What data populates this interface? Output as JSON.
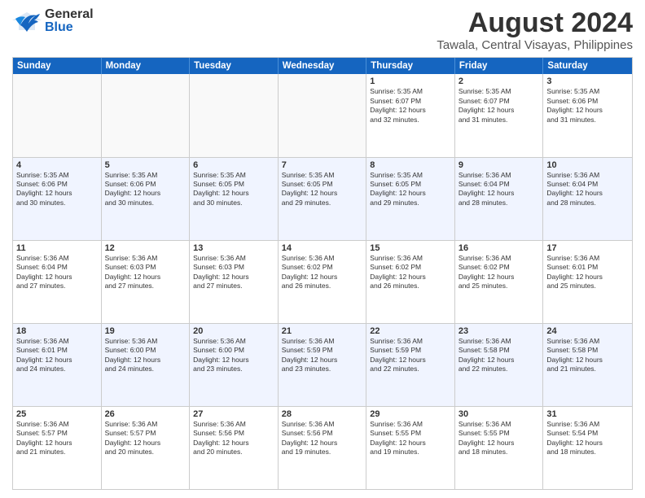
{
  "header": {
    "logo_general": "General",
    "logo_blue": "Blue",
    "title": "August 2024",
    "subtitle": "Tawala, Central Visayas, Philippines"
  },
  "days_of_week": [
    "Sunday",
    "Monday",
    "Tuesday",
    "Wednesday",
    "Thursday",
    "Friday",
    "Saturday"
  ],
  "weeks": [
    [
      {
        "day": "",
        "text": ""
      },
      {
        "day": "",
        "text": ""
      },
      {
        "day": "",
        "text": ""
      },
      {
        "day": "",
        "text": ""
      },
      {
        "day": "1",
        "text": "Sunrise: 5:35 AM\nSunset: 6:07 PM\nDaylight: 12 hours\nand 32 minutes."
      },
      {
        "day": "2",
        "text": "Sunrise: 5:35 AM\nSunset: 6:07 PM\nDaylight: 12 hours\nand 31 minutes."
      },
      {
        "day": "3",
        "text": "Sunrise: 5:35 AM\nSunset: 6:06 PM\nDaylight: 12 hours\nand 31 minutes."
      }
    ],
    [
      {
        "day": "4",
        "text": "Sunrise: 5:35 AM\nSunset: 6:06 PM\nDaylight: 12 hours\nand 30 minutes."
      },
      {
        "day": "5",
        "text": "Sunrise: 5:35 AM\nSunset: 6:06 PM\nDaylight: 12 hours\nand 30 minutes."
      },
      {
        "day": "6",
        "text": "Sunrise: 5:35 AM\nSunset: 6:05 PM\nDaylight: 12 hours\nand 30 minutes."
      },
      {
        "day": "7",
        "text": "Sunrise: 5:35 AM\nSunset: 6:05 PM\nDaylight: 12 hours\nand 29 minutes."
      },
      {
        "day": "8",
        "text": "Sunrise: 5:35 AM\nSunset: 6:05 PM\nDaylight: 12 hours\nand 29 minutes."
      },
      {
        "day": "9",
        "text": "Sunrise: 5:36 AM\nSunset: 6:04 PM\nDaylight: 12 hours\nand 28 minutes."
      },
      {
        "day": "10",
        "text": "Sunrise: 5:36 AM\nSunset: 6:04 PM\nDaylight: 12 hours\nand 28 minutes."
      }
    ],
    [
      {
        "day": "11",
        "text": "Sunrise: 5:36 AM\nSunset: 6:04 PM\nDaylight: 12 hours\nand 27 minutes."
      },
      {
        "day": "12",
        "text": "Sunrise: 5:36 AM\nSunset: 6:03 PM\nDaylight: 12 hours\nand 27 minutes."
      },
      {
        "day": "13",
        "text": "Sunrise: 5:36 AM\nSunset: 6:03 PM\nDaylight: 12 hours\nand 27 minutes."
      },
      {
        "day": "14",
        "text": "Sunrise: 5:36 AM\nSunset: 6:02 PM\nDaylight: 12 hours\nand 26 minutes."
      },
      {
        "day": "15",
        "text": "Sunrise: 5:36 AM\nSunset: 6:02 PM\nDaylight: 12 hours\nand 26 minutes."
      },
      {
        "day": "16",
        "text": "Sunrise: 5:36 AM\nSunset: 6:02 PM\nDaylight: 12 hours\nand 25 minutes."
      },
      {
        "day": "17",
        "text": "Sunrise: 5:36 AM\nSunset: 6:01 PM\nDaylight: 12 hours\nand 25 minutes."
      }
    ],
    [
      {
        "day": "18",
        "text": "Sunrise: 5:36 AM\nSunset: 6:01 PM\nDaylight: 12 hours\nand 24 minutes."
      },
      {
        "day": "19",
        "text": "Sunrise: 5:36 AM\nSunset: 6:00 PM\nDaylight: 12 hours\nand 24 minutes."
      },
      {
        "day": "20",
        "text": "Sunrise: 5:36 AM\nSunset: 6:00 PM\nDaylight: 12 hours\nand 23 minutes."
      },
      {
        "day": "21",
        "text": "Sunrise: 5:36 AM\nSunset: 5:59 PM\nDaylight: 12 hours\nand 23 minutes."
      },
      {
        "day": "22",
        "text": "Sunrise: 5:36 AM\nSunset: 5:59 PM\nDaylight: 12 hours\nand 22 minutes."
      },
      {
        "day": "23",
        "text": "Sunrise: 5:36 AM\nSunset: 5:58 PM\nDaylight: 12 hours\nand 22 minutes."
      },
      {
        "day": "24",
        "text": "Sunrise: 5:36 AM\nSunset: 5:58 PM\nDaylight: 12 hours\nand 21 minutes."
      }
    ],
    [
      {
        "day": "25",
        "text": "Sunrise: 5:36 AM\nSunset: 5:57 PM\nDaylight: 12 hours\nand 21 minutes."
      },
      {
        "day": "26",
        "text": "Sunrise: 5:36 AM\nSunset: 5:57 PM\nDaylight: 12 hours\nand 20 minutes."
      },
      {
        "day": "27",
        "text": "Sunrise: 5:36 AM\nSunset: 5:56 PM\nDaylight: 12 hours\nand 20 minutes."
      },
      {
        "day": "28",
        "text": "Sunrise: 5:36 AM\nSunset: 5:56 PM\nDaylight: 12 hours\nand 19 minutes."
      },
      {
        "day": "29",
        "text": "Sunrise: 5:36 AM\nSunset: 5:55 PM\nDaylight: 12 hours\nand 19 minutes."
      },
      {
        "day": "30",
        "text": "Sunrise: 5:36 AM\nSunset: 5:55 PM\nDaylight: 12 hours\nand 18 minutes."
      },
      {
        "day": "31",
        "text": "Sunrise: 5:36 AM\nSunset: 5:54 PM\nDaylight: 12 hours\nand 18 minutes."
      }
    ]
  ]
}
